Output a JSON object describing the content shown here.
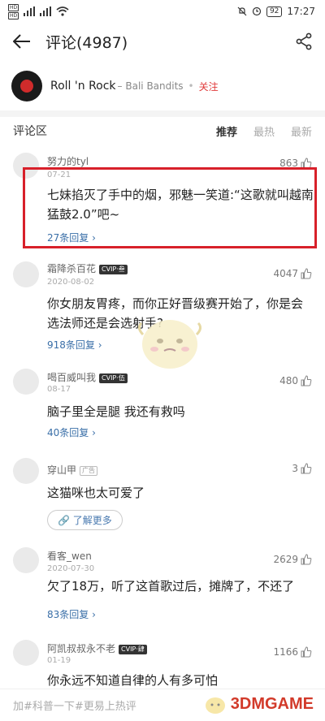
{
  "status_bar": {
    "left_sim1": "HD",
    "left_sim2": "HD",
    "net1": "4G",
    "net2": "4G",
    "battery": "92",
    "time": "17:27"
  },
  "header": {
    "title": "评论(4987)"
  },
  "song": {
    "title": "Roll 'n Rock",
    "artist": "Bali Bandits",
    "follow_label": "关注"
  },
  "section": {
    "title": "评论区",
    "tabs": [
      "推荐",
      "最热",
      "最新"
    ]
  },
  "comments": [
    {
      "name": "努力的tyl",
      "date": "07-21",
      "likes": "863",
      "text": "七妹掐灭了手中的烟，邪魅一笑道:“这歌就叫越南猛鼓2.0”吧~",
      "replies": "27条回复"
    },
    {
      "name": "霜降杀百花",
      "badge": "CVIP·叁",
      "date": "2020-08-02",
      "likes": "4047",
      "text": "你女朋友胃疼，而你正好晋级赛开始了，你是会选法师还是会选射手?",
      "replies": "918条回复"
    },
    {
      "name": "喝百威叫我",
      "badge": "CVIP·伍",
      "date": "08-17",
      "likes": "480",
      "text": "脑子里全是腿 我还有救吗",
      "replies": "40条回复"
    },
    {
      "name": "穿山甲",
      "badge": "广告",
      "date": "",
      "likes": "3",
      "text": "这猫咪也太可爱了",
      "learn_more": "了解更多"
    },
    {
      "name": "看客_wen",
      "date": "2020-07-30",
      "likes": "2629",
      "text": "欠了18万，听了这首歌过后，摊牌了，不还了",
      "replies": "83条回复"
    },
    {
      "name": "阿凯叔叔永不老",
      "badge": "CVIP·肆",
      "date": "01-19",
      "likes": "1166",
      "text": "你永远不知道自律的人有多可怕"
    }
  ],
  "bottom": {
    "input_hint": "加#科普一下#更易上热评",
    "watermark": "3DMGAME"
  },
  "colors": {
    "accent": "#e03a3a",
    "link": "#3a6fa8",
    "highlight": "#d8202a"
  }
}
